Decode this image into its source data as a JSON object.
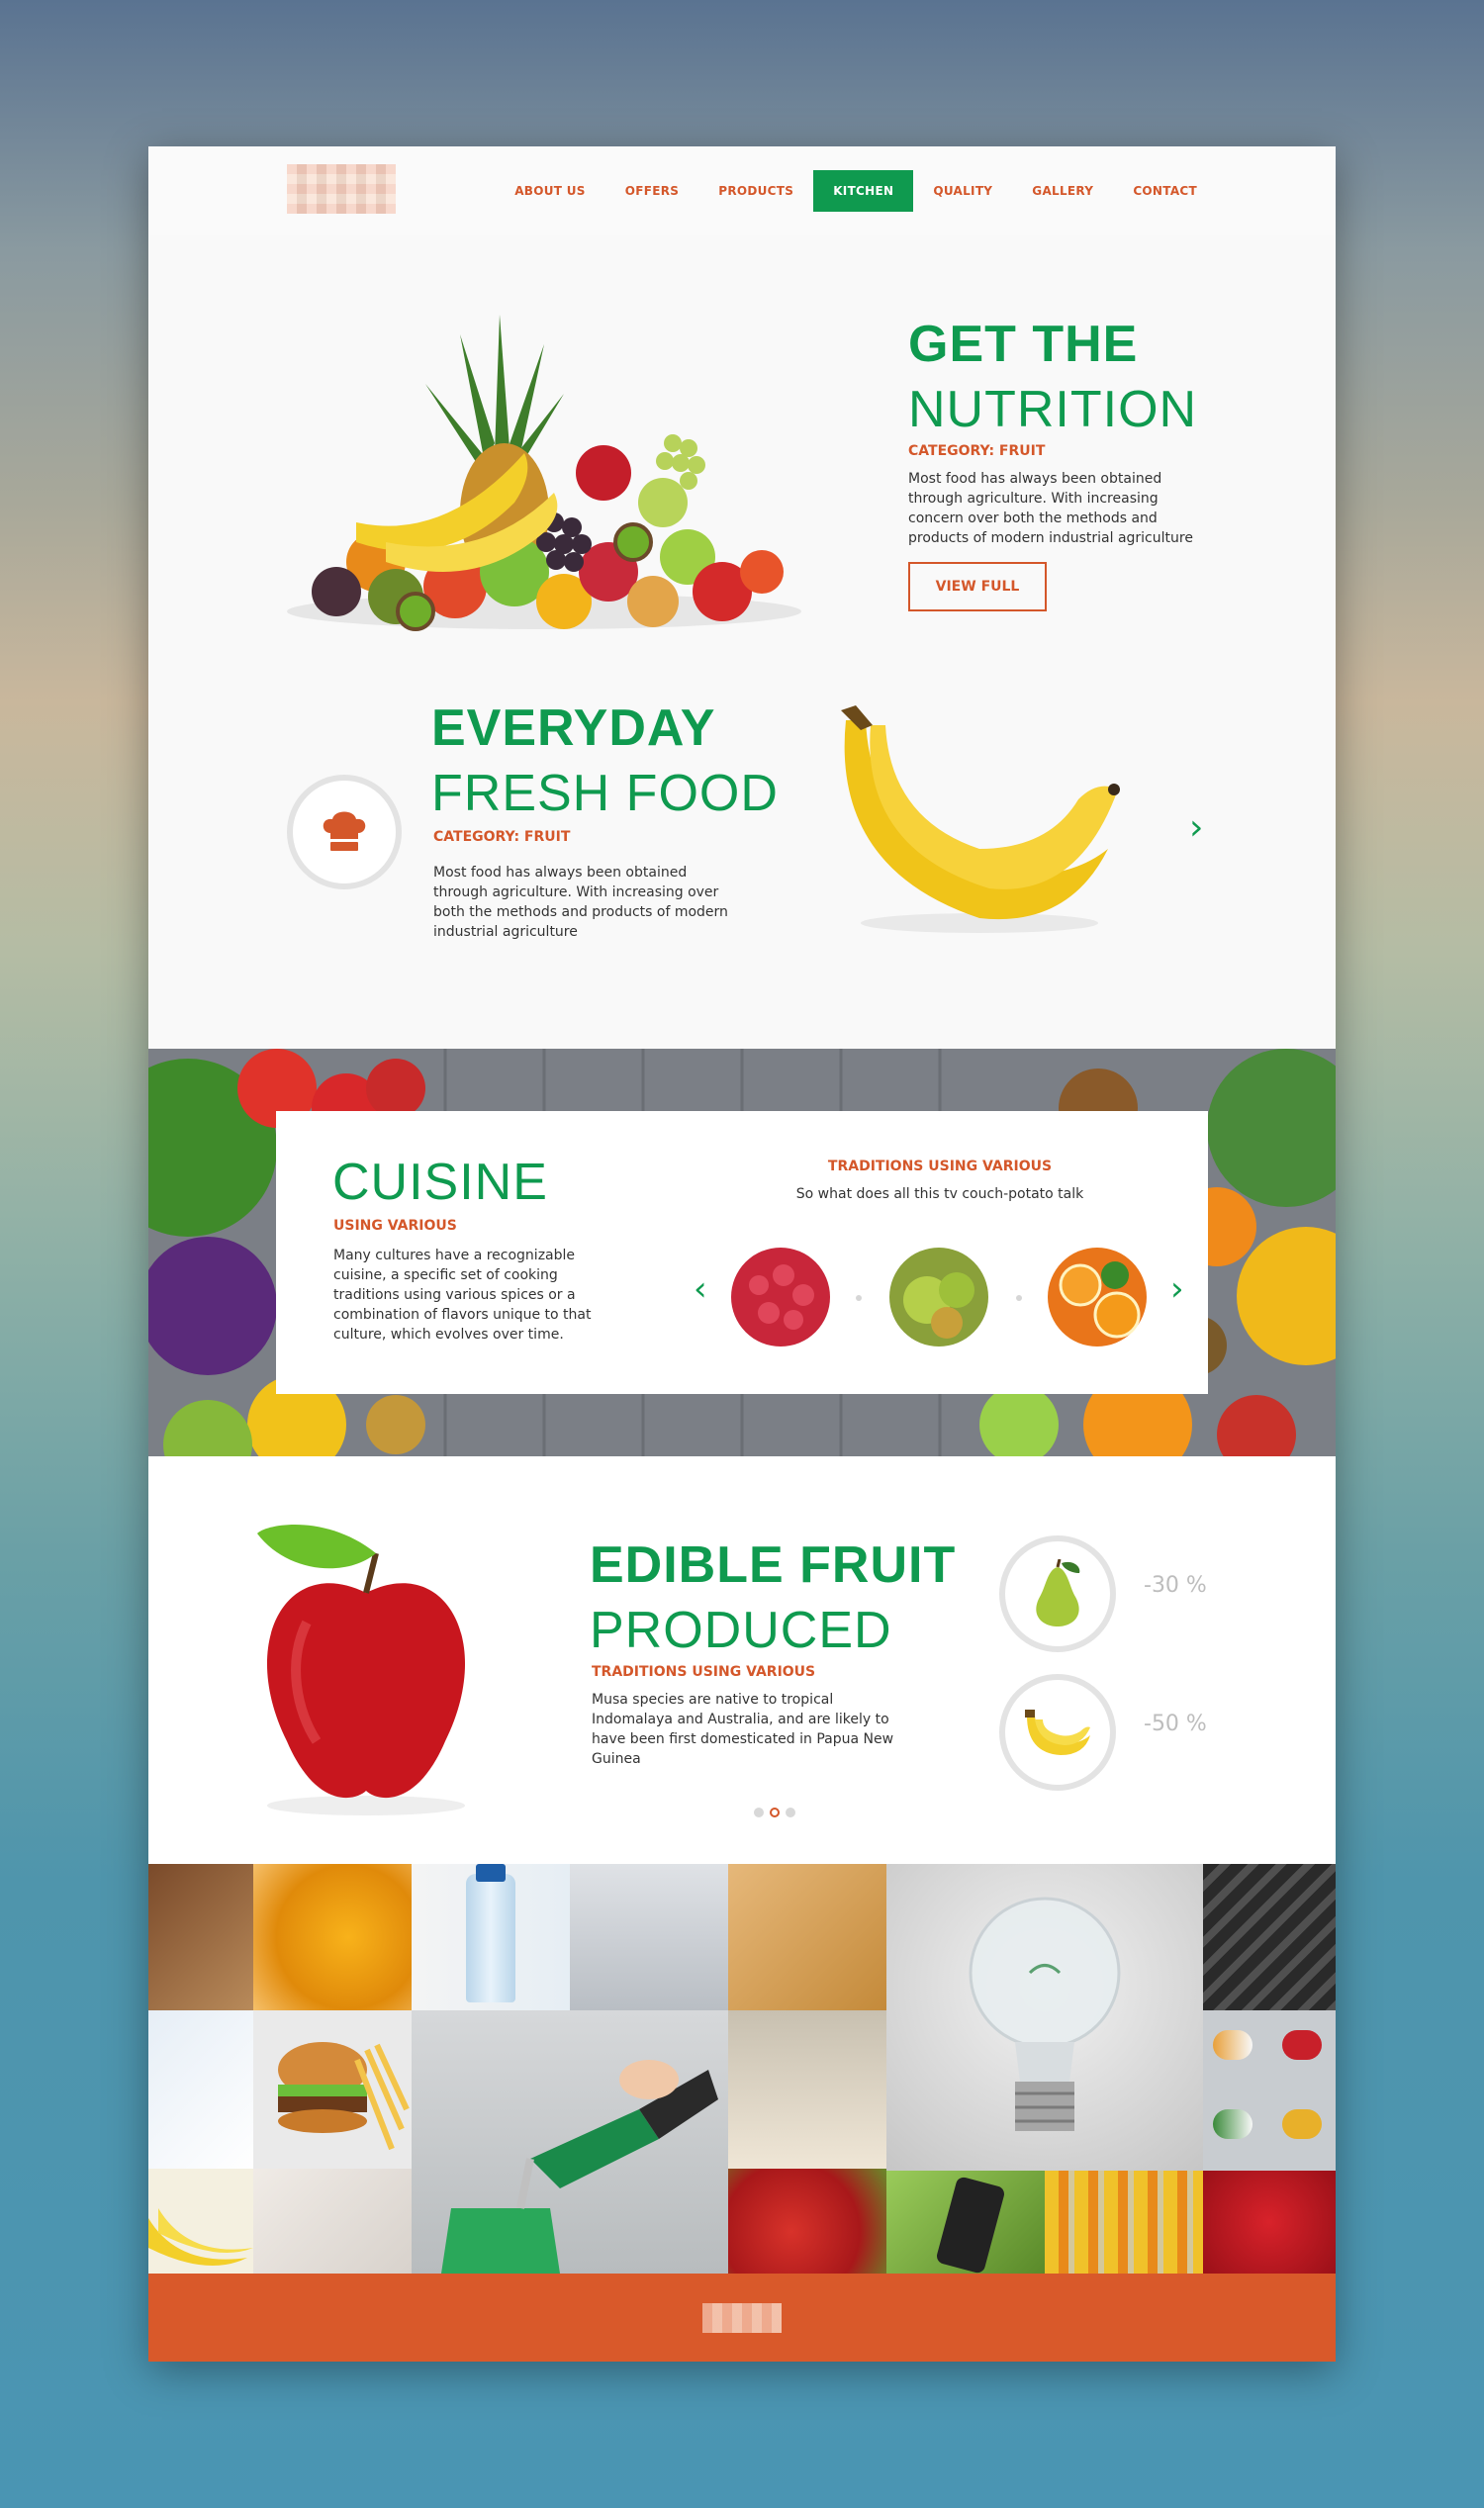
{
  "nav": {
    "items": [
      {
        "label": "ABOUT US"
      },
      {
        "label": "OFFERS"
      },
      {
        "label": "PRODUCTS"
      },
      {
        "label": "KITCHEN"
      },
      {
        "label": "QUALITY"
      },
      {
        "label": "GALLERY"
      },
      {
        "label": "CONTACT"
      }
    ],
    "active": "KITCHEN"
  },
  "hero1": {
    "title_bold": "GET THE",
    "title_light": "NUTRITION",
    "category": "CATEGORY: FRUIT",
    "text": "Most food has always been obtained through agriculture. With increasing concern over both the methods and products of modern industrial agriculture",
    "button": "VIEW FULL"
  },
  "hero2": {
    "title_bold": "EVERYDAY",
    "title_light": "FRESH FOOD",
    "category": "CATEGORY: FRUIT",
    "text": "Most food has always been obtained through agriculture. With increasing over both the methods and products of modern industrial agriculture",
    "icon": "chef-hat-icon"
  },
  "cuisine": {
    "title": "CUISINE",
    "subtitle": "USING VARIOUS",
    "text": "Many cultures have a recognizable cuisine, a specific set of cooking traditions using various spices or a combination of flavors unique to that culture, which evolves over time.",
    "traditions_label": "TRADITIONS USING VARIOUS",
    "traditions_text": "So what does all this tv couch-potato talk"
  },
  "edible": {
    "title_bold": "EDIBLE FRUIT",
    "title_light": "PRODUCED",
    "category": "TRADITIONS USING VARIOUS",
    "text": "Musa species are native to tropical Indomalaya and Australia, and are likely to have been first domesticated in Papua New Guinea",
    "stats": [
      {
        "icon": "pear-icon",
        "value": "-30 %"
      },
      {
        "icon": "banana-icon",
        "value": "-50 %"
      }
    ],
    "pager": {
      "count": 3,
      "active": 2
    }
  },
  "colors": {
    "green": "#0f9a4f",
    "orange": "#d4572a",
    "footer": "#d9592a"
  }
}
